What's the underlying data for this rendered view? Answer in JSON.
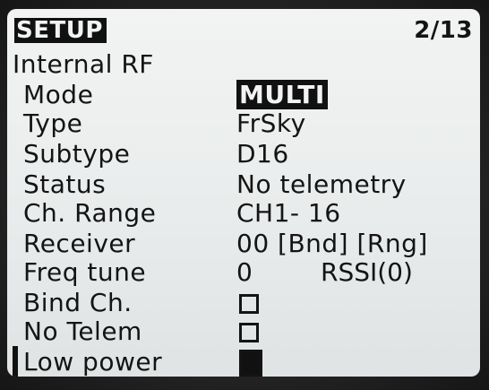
{
  "header": {
    "title": "SETUP",
    "page": "2/13"
  },
  "section": {
    "label": "Internal RF"
  },
  "rows": [
    {
      "label": "Mode",
      "value": "MULTI",
      "selected": true
    },
    {
      "label": "Type",
      "value": "FrSky"
    },
    {
      "label": "Subtype",
      "value": "D16"
    },
    {
      "label": "Status",
      "value": "No telemetry"
    },
    {
      "label": "Ch. Range",
      "value": "CH1- 16"
    },
    {
      "label": "Receiver",
      "value": "00 [Bnd] [Rng]"
    },
    {
      "label": "Freq tune",
      "value": "0",
      "extra": "RSSI(0)"
    },
    {
      "label": "Bind Ch.",
      "value": "",
      "checkbox": false
    },
    {
      "label": "No Telem",
      "value": "",
      "checkbox": false
    },
    {
      "label": "Low power",
      "value": "",
      "checkbox": true,
      "highlighted": true
    }
  ]
}
